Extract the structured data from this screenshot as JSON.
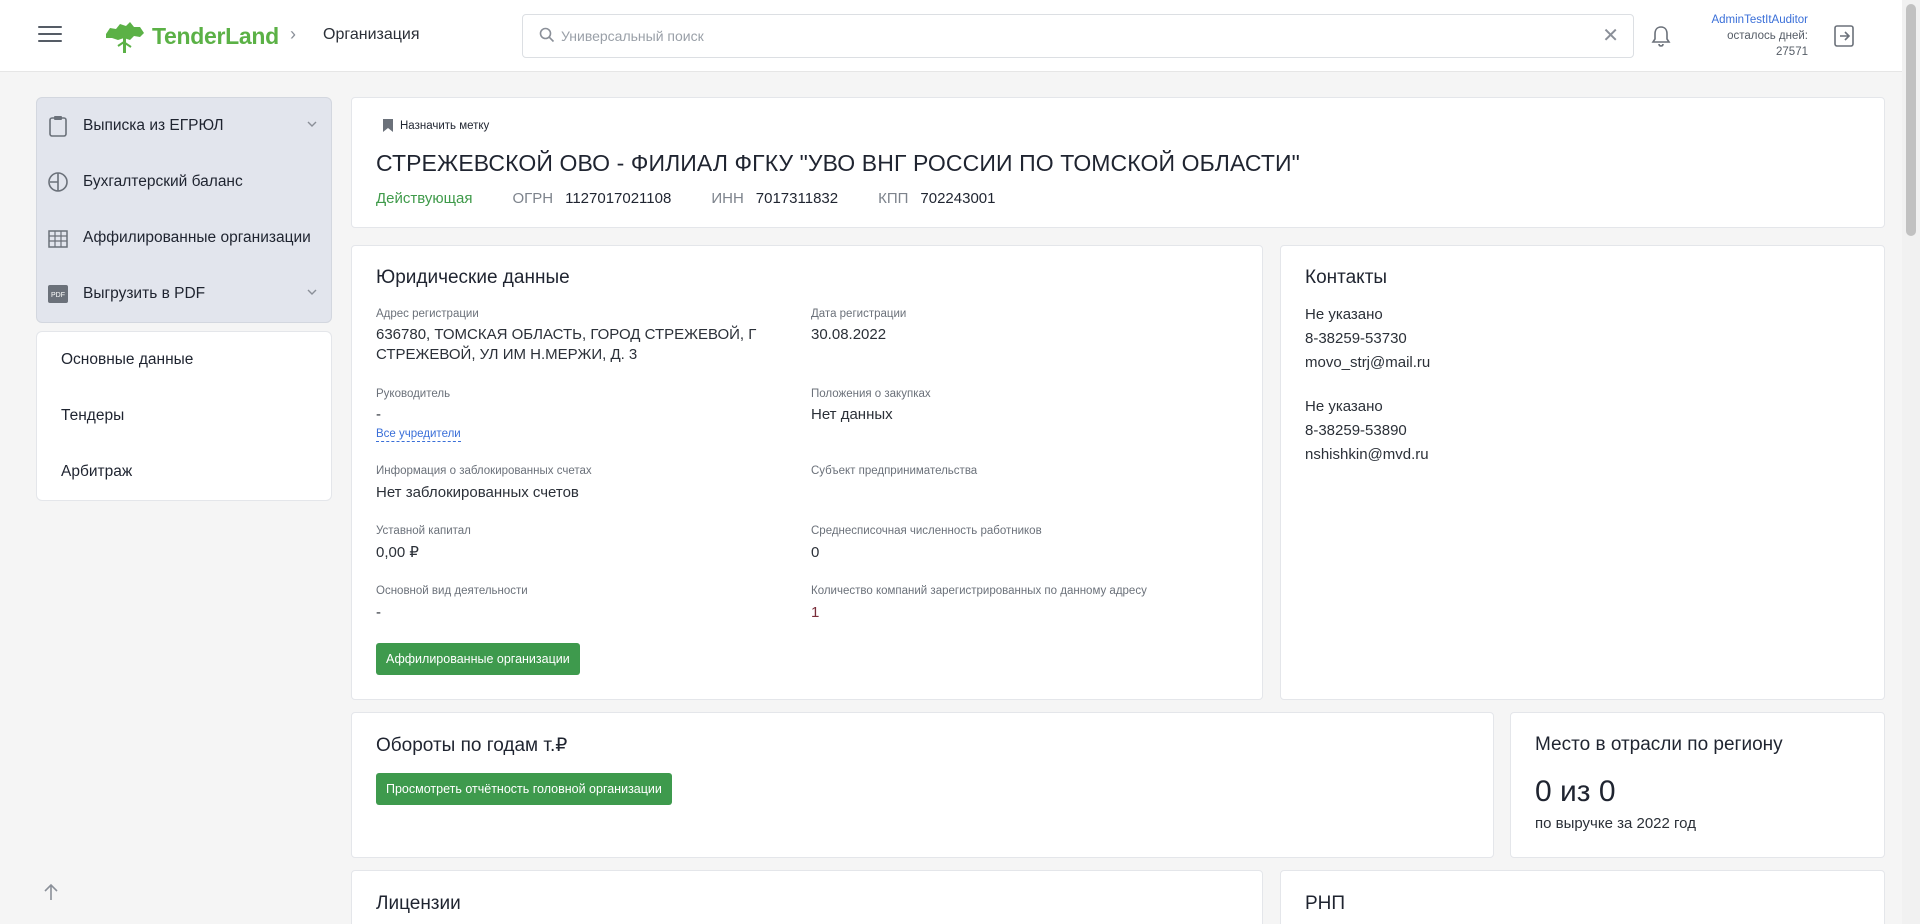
{
  "header": {
    "logo_text": "TenderLand",
    "breadcrumb_current": "Организация",
    "search_placeholder": "Универсальный поиск",
    "user_name": "AdminTestItAuditor",
    "days_left_label": "осталось дней:",
    "days_left_value": "27571"
  },
  "sidebar": {
    "actions": [
      {
        "label": "Выписка из ЕГРЮЛ"
      },
      {
        "label": "Бухгалтерский баланс"
      },
      {
        "label": "Аффилированные организации"
      },
      {
        "label": "Выгрузить в PDF"
      }
    ],
    "nav": [
      {
        "label": "Основные данные"
      },
      {
        "label": "Тендеры"
      },
      {
        "label": "Арбитраж"
      }
    ]
  },
  "org": {
    "assign_label": "Назначить метку",
    "name": "СТРЕЖЕВСКОЙ ОВО - ФИЛИАЛ ФГКУ \"УВО ВНГ РОССИИ ПО ТОМСКОЙ ОБЛАСТИ\"",
    "status": "Действующая",
    "ogrn_label": "ОГРН",
    "ogrn": "1127017021108",
    "inn_label": "ИНН",
    "inn": "7017311832",
    "kpp_label": "КПП",
    "kpp": "702243001"
  },
  "legal": {
    "title": "Юридические данные",
    "address_label": "Адрес регистрации",
    "address_line1": "636780, ТОМСКАЯ ОБЛАСТЬ, ГОРОД СТРЕЖЕВОЙ, Г",
    "address_line2": "СТРЕЖЕВОЙ, УЛ ИМ Н.МЕРЖИ, Д. 3",
    "reg_date_label": "Дата регистрации",
    "reg_date": "30.08.2022",
    "head_label": "Руководитель",
    "head": "-",
    "all_founders": "Все учредители",
    "procurement_label": "Положения о закупках",
    "procurement": "Нет данных",
    "blocked_label": "Информация о заблокированных счетах",
    "blocked": "Нет заблокированных счетов",
    "subject_label": "Субъект предпринимательства",
    "capital_label": "Уставной капитал",
    "capital": "0,00 ₽",
    "employees_label": "Среднесписочная численность работников",
    "employees": "0",
    "activity_label": "Основной вид деятельности",
    "activity": "-",
    "same_address_label": "Количество компаний зарегистрированных по данному адресу",
    "same_address": "1",
    "affiliated_button": "Аффилированные организации"
  },
  "contacts": {
    "title": "Контакты",
    "groups": [
      {
        "name": "Не указано",
        "phone": "8-38259-53730",
        "email": "movo_strj@mail.ru"
      },
      {
        "name": "Не указано",
        "phone": "8-38259-53890",
        "email": "nshishkin@mvd.ru"
      }
    ]
  },
  "turnover": {
    "title": "Обороты по годам т.₽",
    "button": "Просмотреть отчётность головной организации"
  },
  "rank": {
    "title": "Место в отрасли по региону",
    "value": "0 из 0",
    "subtitle": "по выручке за 2022 год"
  },
  "licenses": {
    "title": "Лицензии"
  },
  "rnp": {
    "title": "РНП"
  },
  "colors": {
    "brand": "#5bb146",
    "button": "#3e9a4d",
    "status": "#3f9a4a",
    "link": "#3a6fd8"
  }
}
